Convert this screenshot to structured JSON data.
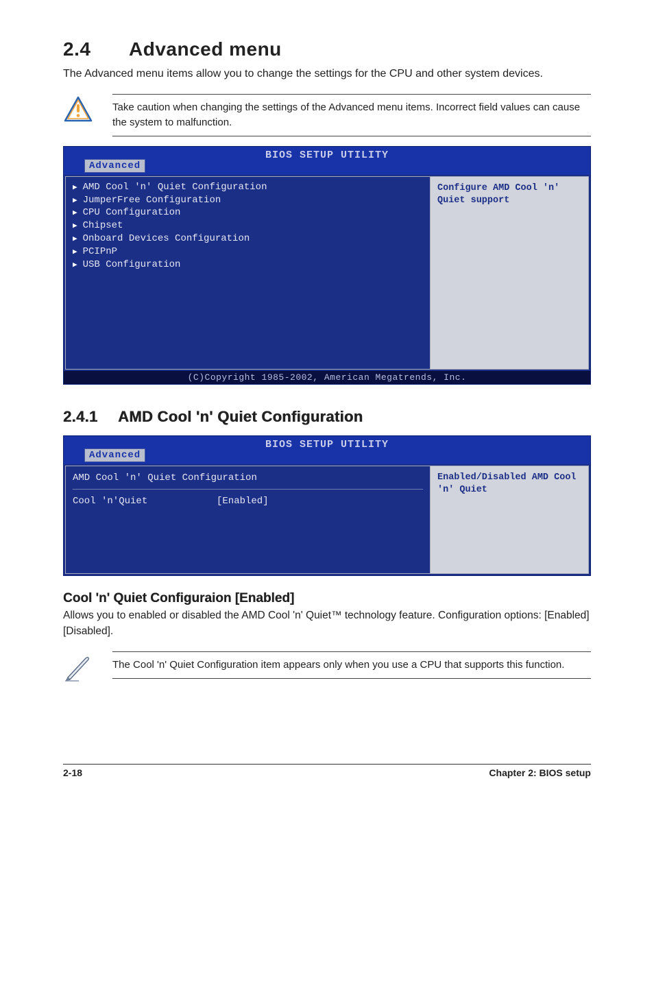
{
  "heading": {
    "number": "2.4",
    "title": "Advanced menu"
  },
  "intro": "The Advanced menu items allow you to change the settings for the CPU and other system devices.",
  "warning": "Take caution when changing the settings of the Advanced menu items. Incorrect field values can cause the system to malfunction.",
  "bios1": {
    "title": "BIOS SETUP UTILITY",
    "tab": "Advanced",
    "items": [
      "AMD Cool 'n' Quiet Configuration",
      "JumperFree Configuration",
      "CPU Configuration",
      "Chipset",
      "Onboard Devices Configuration",
      "PCIPnP",
      "USB Configuration"
    ],
    "help": "Configure AMD Cool 'n' Quiet support",
    "copyright": "(C)Copyright 1985-2002, American Megatrends, Inc."
  },
  "sub1": {
    "number": "2.4.1",
    "title": "AMD Cool 'n' Quiet Configuration"
  },
  "bios2": {
    "title": "BIOS SETUP UTILITY",
    "tab": "Advanced",
    "section_title": "AMD Cool 'n' Quiet Configuration",
    "option_label": "Cool 'n'Quiet",
    "option_value": "[Enabled]",
    "help": "Enabled/Disabled AMD Cool 'n' Quiet"
  },
  "option": {
    "heading": "Cool 'n' Quiet Configuraion [Enabled]",
    "body": "Allows you to enabled or disabled the AMD Cool 'n' Quiet™ technology feature. Configuration options: [Enabled] [Disabled]."
  },
  "note": "The Cool 'n' Quiet Configuration item appears only when you use a CPU that supports this function.",
  "footer": {
    "left": "2-18",
    "right": "Chapter 2: BIOS setup"
  }
}
